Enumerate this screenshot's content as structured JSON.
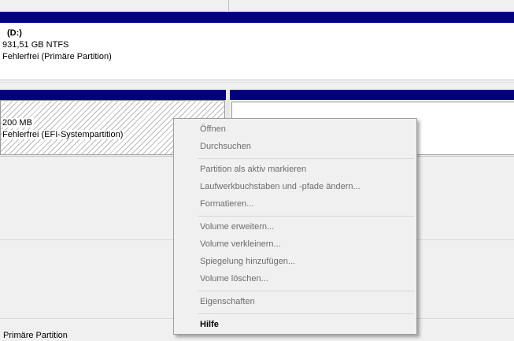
{
  "disk_d": {
    "name": "(D:)",
    "size": "931,51 GB NTFS",
    "status": "Fehlerfrei (Primäre Partition)"
  },
  "efi_partition": {
    "size": "200 MB",
    "status": "Fehlerfrei (EFI-Systempartition)"
  },
  "legend": {
    "primary_label": "Primäre Partition"
  },
  "context_menu": {
    "groups": [
      [
        {
          "label": "Öffnen",
          "enabled": false
        },
        {
          "label": "Durchsuchen",
          "enabled": false
        }
      ],
      [
        {
          "label": "Partition als aktiv markieren",
          "enabled": false
        },
        {
          "label": "Laufwerkbuchstaben und -pfade ändern...",
          "enabled": false
        },
        {
          "label": "Formatieren...",
          "enabled": false
        }
      ],
      [
        {
          "label": "Volume erweitern...",
          "enabled": false
        },
        {
          "label": "Volume verkleinern...",
          "enabled": false
        },
        {
          "label": "Spiegelung hinzufügen...",
          "enabled": false
        },
        {
          "label": "Volume löschen...",
          "enabled": false
        }
      ],
      [
        {
          "label": "Eigenschaften",
          "enabled": false
        }
      ],
      [
        {
          "label": "Hilfe",
          "enabled": true
        }
      ]
    ]
  },
  "colors": {
    "partition_header": "#000080",
    "menu_background": "#f0f0f0",
    "disabled_text": "#6d6d6d"
  }
}
